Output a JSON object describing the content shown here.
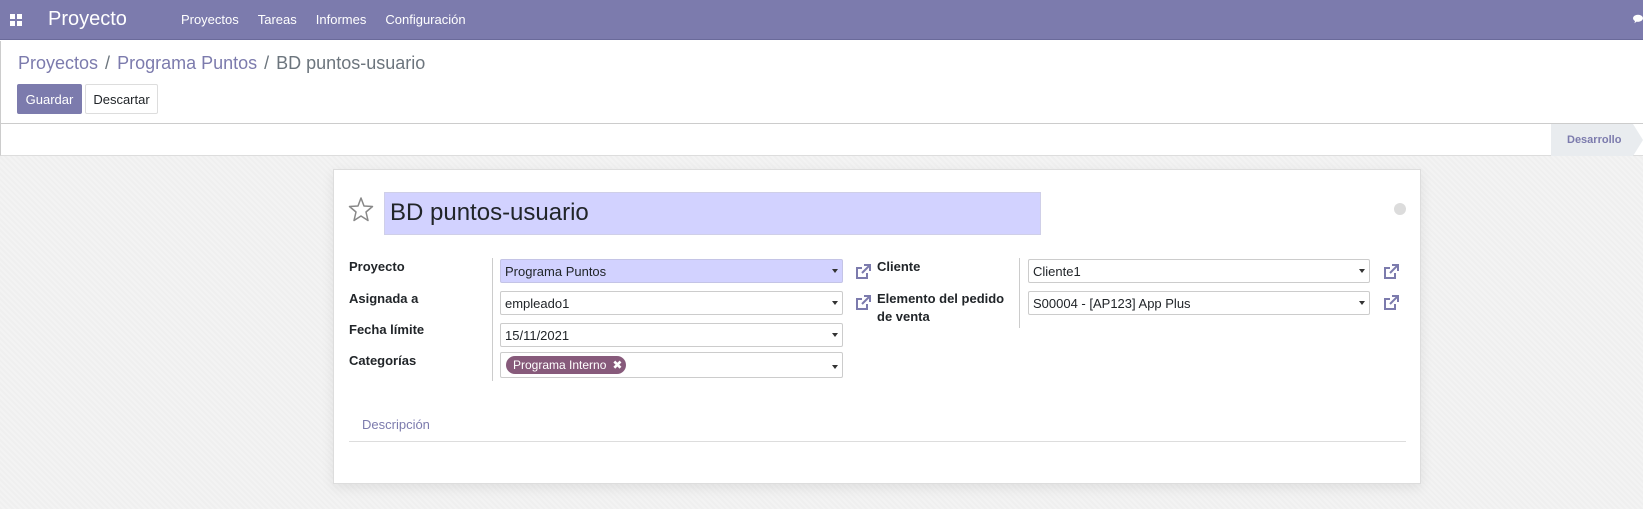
{
  "navbar": {
    "app_name": "Proyecto",
    "menu": [
      "Proyectos",
      "Tareas",
      "Informes",
      "Configuración"
    ],
    "color": "#7C7BAD"
  },
  "breadcrumb": {
    "items": [
      "Proyectos",
      "Programa Puntos"
    ],
    "active": "BD puntos-usuario",
    "separator": "/"
  },
  "buttons": {
    "save": "Guardar",
    "discard": "Descartar"
  },
  "statusbar": {
    "stage": "Desarrollo"
  },
  "form": {
    "title": "BD puntos-usuario",
    "fields": {
      "project": {
        "label": "Proyecto",
        "value": "Programa Puntos"
      },
      "assigned": {
        "label": "Asignada a",
        "value": "empleado1"
      },
      "deadline": {
        "label": "Fecha límite",
        "value": "15/11/2021"
      },
      "categories": {
        "label": "Categorías",
        "tags": [
          "Programa Interno"
        ]
      },
      "customer": {
        "label": "Cliente",
        "value": "Cliente1"
      },
      "sale_line": {
        "label_line1": "Elemento del pedido",
        "label_line2": "de venta",
        "value": "S00004 - [AP123] App Plus"
      }
    },
    "tabs": [
      "Descripción"
    ]
  },
  "colors": {
    "primary": "#7C7BAD",
    "tag": "#875A7B",
    "highlight": "#D2D2FF"
  }
}
